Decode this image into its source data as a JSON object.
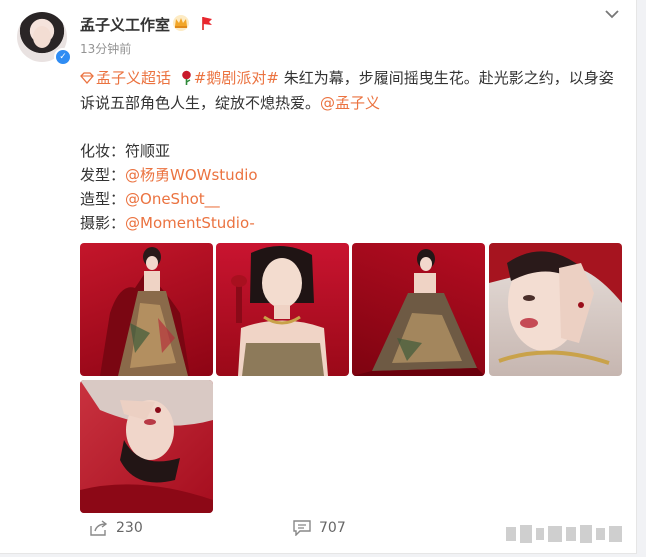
{
  "post": {
    "author": "孟子义工作室",
    "time": "13分钟前",
    "supertopic": "孟子义超话",
    "hashtag": "#鹅剧派对#",
    "body": " 朱红为幕，步履间摇曳生花。赴光影之约，以身姿诉说五部角色人生，绽放不熄热爱。",
    "mention": "@孟子义",
    "credits": [
      {
        "label": "化妆：",
        "value": "符顺亚",
        "is_link": false
      },
      {
        "label": "发型：",
        "value": "@杨勇WOWstudio",
        "is_link": true
      },
      {
        "label": "造型：",
        "value": "@OneShot__",
        "is_link": true
      },
      {
        "label": "摄影：",
        "value": "@MomentStudio-",
        "is_link": true
      }
    ],
    "images": [
      "photo-1",
      "photo-2",
      "photo-3",
      "photo-4",
      "photo-5"
    ]
  },
  "actions": {
    "share_count": "230",
    "comment_count": "707"
  },
  "icons": {
    "verified": "verified-badge-icon",
    "crown": "crown-badge-icon",
    "flag": "flag-badge-icon",
    "supertopic": "diamond-icon",
    "rose": "rose-icon",
    "more": "chevron-down-icon",
    "share": "share-icon",
    "comment": "comment-icon"
  },
  "colors": {
    "link": "#eb7340",
    "verified": "#2f8cf3",
    "text": "#333333",
    "muted": "#939393",
    "backdrop_red": "#b8001b"
  }
}
